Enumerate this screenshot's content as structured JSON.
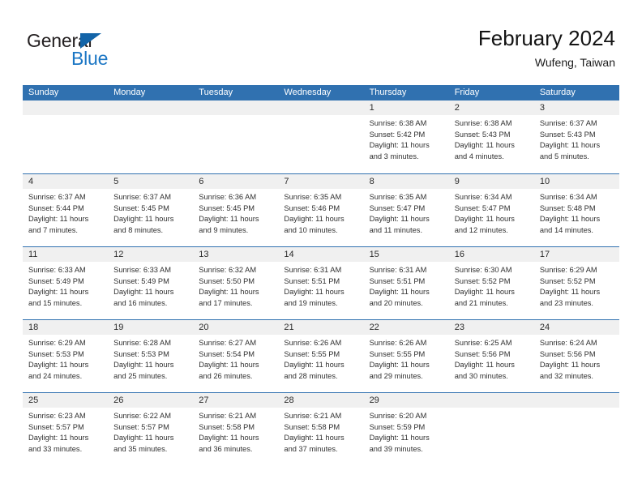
{
  "logo": {
    "word_top": "General",
    "word_bottom": "Blue",
    "triangle_color": "#1364a8",
    "blue_color": "#1b76c4"
  },
  "header": {
    "title": "February 2024",
    "subtitle": "Wufeng, Taiwan"
  },
  "theme": {
    "header_blue": "#3071b0",
    "date_band_gray": "#f0f0f0",
    "text_color": "#303030"
  },
  "calendar": {
    "day_headers": [
      "Sunday",
      "Monday",
      "Tuesday",
      "Wednesday",
      "Thursday",
      "Friday",
      "Saturday"
    ],
    "labels": {
      "sunrise": "Sunrise:",
      "sunset": "Sunset:",
      "daylight": "Daylight:"
    },
    "weeks": [
      [
        {
          "empty": true
        },
        {
          "empty": true
        },
        {
          "empty": true
        },
        {
          "empty": true
        },
        {
          "day": "1",
          "sunrise": "Sunrise: 6:38 AM",
          "sunset": "Sunset: 5:42 PM",
          "daylight_1": "Daylight: 11 hours",
          "daylight_2": "and 3 minutes."
        },
        {
          "day": "2",
          "sunrise": "Sunrise: 6:38 AM",
          "sunset": "Sunset: 5:43 PM",
          "daylight_1": "Daylight: 11 hours",
          "daylight_2": "and 4 minutes."
        },
        {
          "day": "3",
          "sunrise": "Sunrise: 6:37 AM",
          "sunset": "Sunset: 5:43 PM",
          "daylight_1": "Daylight: 11 hours",
          "daylight_2": "and 5 minutes."
        }
      ],
      [
        {
          "day": "4",
          "sunrise": "Sunrise: 6:37 AM",
          "sunset": "Sunset: 5:44 PM",
          "daylight_1": "Daylight: 11 hours",
          "daylight_2": "and 7 minutes."
        },
        {
          "day": "5",
          "sunrise": "Sunrise: 6:37 AM",
          "sunset": "Sunset: 5:45 PM",
          "daylight_1": "Daylight: 11 hours",
          "daylight_2": "and 8 minutes."
        },
        {
          "day": "6",
          "sunrise": "Sunrise: 6:36 AM",
          "sunset": "Sunset: 5:45 PM",
          "daylight_1": "Daylight: 11 hours",
          "daylight_2": "and 9 minutes."
        },
        {
          "day": "7",
          "sunrise": "Sunrise: 6:35 AM",
          "sunset": "Sunset: 5:46 PM",
          "daylight_1": "Daylight: 11 hours",
          "daylight_2": "and 10 minutes."
        },
        {
          "day": "8",
          "sunrise": "Sunrise: 6:35 AM",
          "sunset": "Sunset: 5:47 PM",
          "daylight_1": "Daylight: 11 hours",
          "daylight_2": "and 11 minutes."
        },
        {
          "day": "9",
          "sunrise": "Sunrise: 6:34 AM",
          "sunset": "Sunset: 5:47 PM",
          "daylight_1": "Daylight: 11 hours",
          "daylight_2": "and 12 minutes."
        },
        {
          "day": "10",
          "sunrise": "Sunrise: 6:34 AM",
          "sunset": "Sunset: 5:48 PM",
          "daylight_1": "Daylight: 11 hours",
          "daylight_2": "and 14 minutes."
        }
      ],
      [
        {
          "day": "11",
          "sunrise": "Sunrise: 6:33 AM",
          "sunset": "Sunset: 5:49 PM",
          "daylight_1": "Daylight: 11 hours",
          "daylight_2": "and 15 minutes."
        },
        {
          "day": "12",
          "sunrise": "Sunrise: 6:33 AM",
          "sunset": "Sunset: 5:49 PM",
          "daylight_1": "Daylight: 11 hours",
          "daylight_2": "and 16 minutes."
        },
        {
          "day": "13",
          "sunrise": "Sunrise: 6:32 AM",
          "sunset": "Sunset: 5:50 PM",
          "daylight_1": "Daylight: 11 hours",
          "daylight_2": "and 17 minutes."
        },
        {
          "day": "14",
          "sunrise": "Sunrise: 6:31 AM",
          "sunset": "Sunset: 5:51 PM",
          "daylight_1": "Daylight: 11 hours",
          "daylight_2": "and 19 minutes."
        },
        {
          "day": "15",
          "sunrise": "Sunrise: 6:31 AM",
          "sunset": "Sunset: 5:51 PM",
          "daylight_1": "Daylight: 11 hours",
          "daylight_2": "and 20 minutes."
        },
        {
          "day": "16",
          "sunrise": "Sunrise: 6:30 AM",
          "sunset": "Sunset: 5:52 PM",
          "daylight_1": "Daylight: 11 hours",
          "daylight_2": "and 21 minutes."
        },
        {
          "day": "17",
          "sunrise": "Sunrise: 6:29 AM",
          "sunset": "Sunset: 5:52 PM",
          "daylight_1": "Daylight: 11 hours",
          "daylight_2": "and 23 minutes."
        }
      ],
      [
        {
          "day": "18",
          "sunrise": "Sunrise: 6:29 AM",
          "sunset": "Sunset: 5:53 PM",
          "daylight_1": "Daylight: 11 hours",
          "daylight_2": "and 24 minutes."
        },
        {
          "day": "19",
          "sunrise": "Sunrise: 6:28 AM",
          "sunset": "Sunset: 5:53 PM",
          "daylight_1": "Daylight: 11 hours",
          "daylight_2": "and 25 minutes."
        },
        {
          "day": "20",
          "sunrise": "Sunrise: 6:27 AM",
          "sunset": "Sunset: 5:54 PM",
          "daylight_1": "Daylight: 11 hours",
          "daylight_2": "and 26 minutes."
        },
        {
          "day": "21",
          "sunrise": "Sunrise: 6:26 AM",
          "sunset": "Sunset: 5:55 PM",
          "daylight_1": "Daylight: 11 hours",
          "daylight_2": "and 28 minutes."
        },
        {
          "day": "22",
          "sunrise": "Sunrise: 6:26 AM",
          "sunset": "Sunset: 5:55 PM",
          "daylight_1": "Daylight: 11 hours",
          "daylight_2": "and 29 minutes."
        },
        {
          "day": "23",
          "sunrise": "Sunrise: 6:25 AM",
          "sunset": "Sunset: 5:56 PM",
          "daylight_1": "Daylight: 11 hours",
          "daylight_2": "and 30 minutes."
        },
        {
          "day": "24",
          "sunrise": "Sunrise: 6:24 AM",
          "sunset": "Sunset: 5:56 PM",
          "daylight_1": "Daylight: 11 hours",
          "daylight_2": "and 32 minutes."
        }
      ],
      [
        {
          "day": "25",
          "sunrise": "Sunrise: 6:23 AM",
          "sunset": "Sunset: 5:57 PM",
          "daylight_1": "Daylight: 11 hours",
          "daylight_2": "and 33 minutes."
        },
        {
          "day": "26",
          "sunrise": "Sunrise: 6:22 AM",
          "sunset": "Sunset: 5:57 PM",
          "daylight_1": "Daylight: 11 hours",
          "daylight_2": "and 35 minutes."
        },
        {
          "day": "27",
          "sunrise": "Sunrise: 6:21 AM",
          "sunset": "Sunset: 5:58 PM",
          "daylight_1": "Daylight: 11 hours",
          "daylight_2": "and 36 minutes."
        },
        {
          "day": "28",
          "sunrise": "Sunrise: 6:21 AM",
          "sunset": "Sunset: 5:58 PM",
          "daylight_1": "Daylight: 11 hours",
          "daylight_2": "and 37 minutes."
        },
        {
          "day": "29",
          "sunrise": "Sunrise: 6:20 AM",
          "sunset": "Sunset: 5:59 PM",
          "daylight_1": "Daylight: 11 hours",
          "daylight_2": "and 39 minutes."
        },
        {
          "empty": true
        },
        {
          "empty": true
        }
      ]
    ]
  }
}
